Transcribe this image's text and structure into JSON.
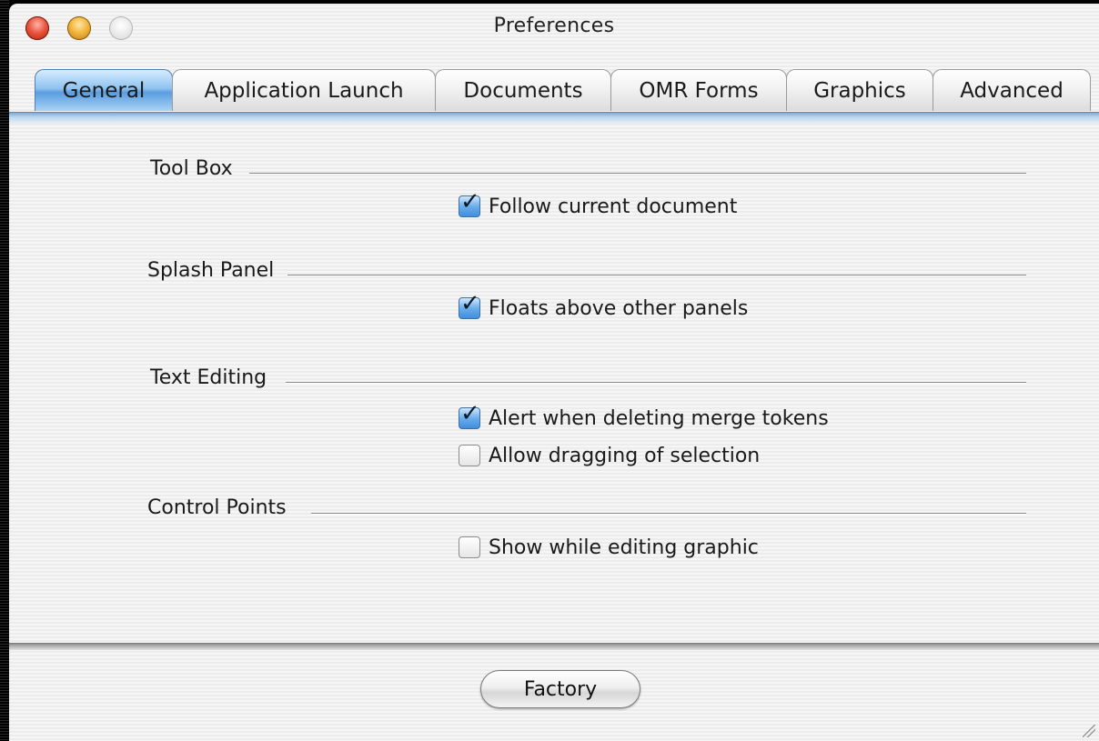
{
  "window": {
    "title": "Preferences"
  },
  "tabs": [
    {
      "label": "General",
      "active": true
    },
    {
      "label": "Application Launch",
      "active": false
    },
    {
      "label": "Documents",
      "active": false
    },
    {
      "label": "OMR Forms",
      "active": false
    },
    {
      "label": "Graphics",
      "active": false
    },
    {
      "label": "Advanced",
      "active": false
    }
  ],
  "groups": {
    "tool_box": {
      "title": "Tool Box",
      "options": [
        {
          "label": "Follow current document",
          "checked": true
        }
      ]
    },
    "splash_panel": {
      "title": "Splash Panel",
      "options": [
        {
          "label": "Floats above other panels",
          "checked": true
        }
      ]
    },
    "text_editing": {
      "title": "Text Editing",
      "options": [
        {
          "label": "Alert when deleting merge tokens",
          "checked": true
        },
        {
          "label": "Allow dragging of selection",
          "checked": false
        }
      ]
    },
    "control_points": {
      "title": "Control Points",
      "options": [
        {
          "label": "Show while editing graphic",
          "checked": false
        }
      ]
    }
  },
  "buttons": {
    "factory_label": "Factory"
  },
  "colors": {
    "active_tab": "#5a9de0",
    "checkbox_checked": "#3f8ee0",
    "close": "#e8553d",
    "minimize": "#f2b53a",
    "zoom": "#cfcfcf"
  },
  "icons": {
    "checkmark": "checkmark-icon",
    "close": "close-icon",
    "minimize": "minimize-icon",
    "zoom": "zoom-icon",
    "resize": "resize-grip-icon"
  }
}
